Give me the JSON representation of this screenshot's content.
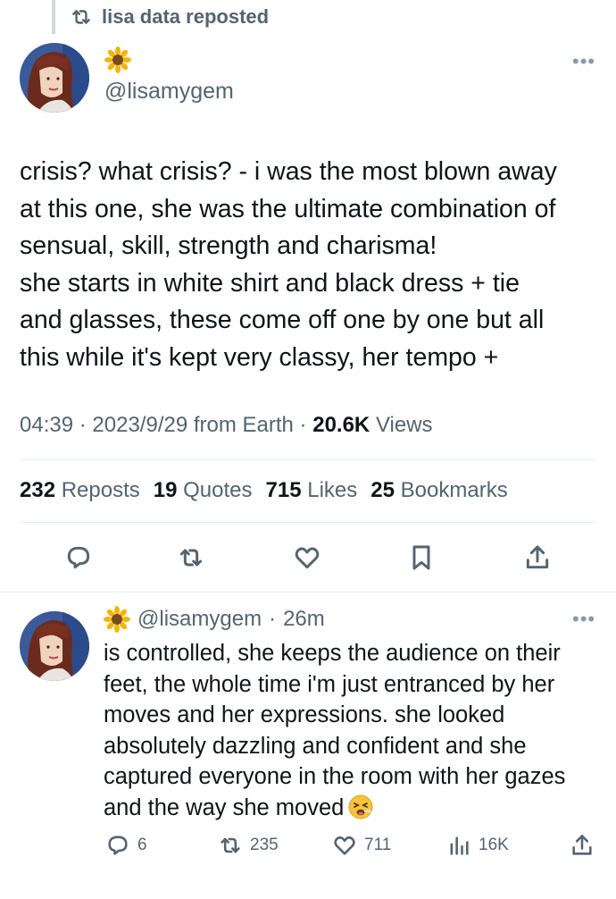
{
  "repost_banner": {
    "text": "lisa data reposted"
  },
  "main_tweet": {
    "display_name_emoji": "sunflower-icon",
    "handle": "@lisamygem",
    "lines": [
      "crisis? what crisis? - i was the most blown away",
      "at this one, she was the ultimate combination of",
      "sensual, skill, strength and charisma!",
      "she starts in white shirt and black dress + tie",
      "and glasses, these come off one by one but all",
      "this while it's kept very classy, her tempo +"
    ],
    "time": "04:39",
    "date": "2023/9/29 from Earth",
    "views_count": "20.6K",
    "views_label": "Views",
    "sep": "·",
    "stats": {
      "reposts_count": "232",
      "reposts_label": "Reposts",
      "quotes_count": "19",
      "quotes_label": "Quotes",
      "likes_count": "715",
      "likes_label": "Likes",
      "bookmarks_count": "25",
      "bookmarks_label": "Bookmarks"
    }
  },
  "reply_tweet": {
    "handle": "@lisamygem",
    "sep": "·",
    "time_ago": "26m",
    "lines": [
      "is controlled, she keeps the audience on their",
      "feet, the whole time i'm just entranced by her",
      "moves and her expressions. she looked",
      "absolutely dazzling and confident and she",
      "captured everyone in the room with her gazes",
      "and the way she moved"
    ],
    "trailing_emoji": "tired-face-icon",
    "actions": {
      "replies": "6",
      "reposts": "235",
      "likes": "711",
      "views": "16K"
    }
  },
  "colors": {
    "text": "#0f1419",
    "secondary": "#536471",
    "divider": "#e6ecf0"
  }
}
